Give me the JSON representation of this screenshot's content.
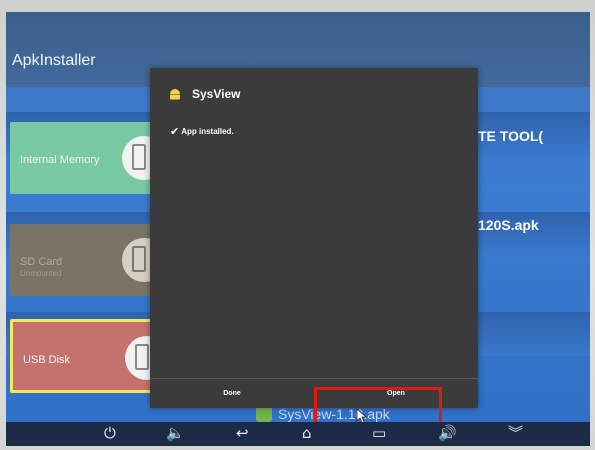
{
  "app": {
    "title": "ApkInstaller"
  },
  "storage": [
    {
      "label": "Internal Memory",
      "sub": ""
    },
    {
      "label": "SD Card",
      "sub": "Unmounted"
    },
    {
      "label": "USB Disk",
      "sub": ""
    }
  ],
  "files": {
    "tool": "TE TOOL(",
    "apk": "120S.apk",
    "behind": "SysView-1.10.apk"
  },
  "dialog": {
    "title": "SysView",
    "message": "App installed.",
    "done_label": "Done",
    "open_label": "Open"
  },
  "nav_icons": [
    "power-icon",
    "volume-down-icon",
    "back-icon",
    "home-icon",
    "recent-apps-icon",
    "volume-up-icon",
    "collapse-icon"
  ],
  "colors": {
    "highlight": "#e01818",
    "selected_tile_border": "#f4e85d",
    "dialog_bg": "#3b3b3b"
  }
}
